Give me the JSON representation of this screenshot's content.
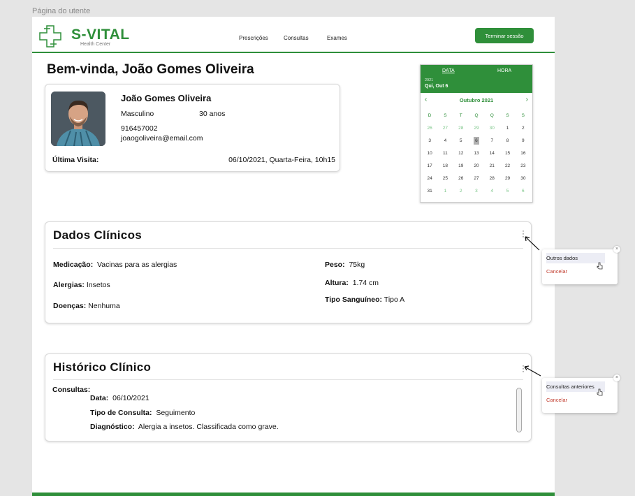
{
  "frame_label": "Página do utente",
  "header": {
    "brand": "S-VITAL",
    "brand_sub": "Health Center",
    "nav": [
      "Prescrições",
      "Consultas",
      "Exames"
    ],
    "logout": "Terminar sessão"
  },
  "welcome": "Bem-vinda, João Gomes Oliveira",
  "patient": {
    "name": "João Gomes Oliveira",
    "sex": "Masculino",
    "age": "30 anos",
    "phone": "916457002",
    "email": "joaogoliveira@email.com",
    "last_visit_label": "Última Visita:",
    "last_visit_value": "06/10/2021, Quarta-Feira, 10h15"
  },
  "calendar": {
    "tab_data": "DATA",
    "tab_hora": "HORA",
    "year": "2021",
    "date": "Qui, Out 6",
    "prev": "‹",
    "next": "›",
    "month": "Outubro 2021",
    "weekdays": [
      "D",
      "S",
      "T",
      "Q",
      "Q",
      "S",
      "S"
    ],
    "days": [
      {
        "d": "26",
        "other": true
      },
      {
        "d": "27",
        "other": true
      },
      {
        "d": "28",
        "other": true
      },
      {
        "d": "29",
        "other": true
      },
      {
        "d": "30",
        "other": true
      },
      {
        "d": "1"
      },
      {
        "d": "2"
      },
      {
        "d": "3"
      },
      {
        "d": "4"
      },
      {
        "d": "5"
      },
      {
        "d": "6",
        "selected": true
      },
      {
        "d": "7"
      },
      {
        "d": "8"
      },
      {
        "d": "9"
      },
      {
        "d": "10"
      },
      {
        "d": "11"
      },
      {
        "d": "12"
      },
      {
        "d": "13"
      },
      {
        "d": "14"
      },
      {
        "d": "15"
      },
      {
        "d": "16"
      },
      {
        "d": "17"
      },
      {
        "d": "18"
      },
      {
        "d": "19"
      },
      {
        "d": "20"
      },
      {
        "d": "21"
      },
      {
        "d": "22"
      },
      {
        "d": "23"
      },
      {
        "d": "24"
      },
      {
        "d": "25"
      },
      {
        "d": "26"
      },
      {
        "d": "27"
      },
      {
        "d": "28"
      },
      {
        "d": "29"
      },
      {
        "d": "30"
      },
      {
        "d": "31"
      },
      {
        "d": "1",
        "other": true
      },
      {
        "d": "2",
        "other": true
      },
      {
        "d": "3",
        "other": true
      },
      {
        "d": "4",
        "other": true
      },
      {
        "d": "5",
        "other": true
      },
      {
        "d": "6",
        "other": true
      }
    ]
  },
  "clinical": {
    "title": "Dados Clínicos",
    "medication_label": "Medicação:",
    "medication_value": "Vacinas para as alergias",
    "allergies_label": "Alergias:",
    "allergies_value": "Insetos",
    "diseases_label": "Doenças:",
    "diseases_value": "Nenhuma",
    "weight_label": "Peso:",
    "weight_value": "75kg",
    "height_label": "Altura:",
    "height_value": "1.74 cm",
    "blood_label": "Tipo Sanguíneo:",
    "blood_value": "Tipo A",
    "popover_option": "Outros dados",
    "popover_cancel": "Cancelar"
  },
  "history": {
    "title": "Histórico Clínico",
    "consultations_label": "Consultas:",
    "date_label": "Data:",
    "date_value": "06/10/2021",
    "type_label": "Tipo de Consulta:",
    "type_value": "Seguimento",
    "diagnosis_label": "Diagnóstico:",
    "diagnosis_value": "Alergia a insetos. Classificada como grave.",
    "popover_option": "Consultas anteriores",
    "popover_cancel": "Cancelar"
  },
  "icons": {
    "logo": "medical-cross-logo-icon",
    "close": "close-icon",
    "menu": "vertical-dots-icon",
    "cursor": "hand-cursor-icon"
  },
  "colors": {
    "brand_green": "#2f8f3a",
    "cancel_red": "#c0392b",
    "other_month_day": "#7ac587"
  }
}
